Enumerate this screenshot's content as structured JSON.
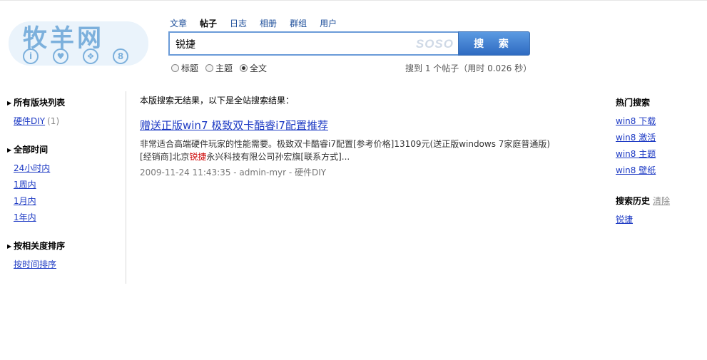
{
  "logo": {
    "brand": "牧羊网",
    "dots": [
      "i",
      "♥",
      "❖",
      "8"
    ]
  },
  "search": {
    "tabs": [
      "文章",
      "帖子",
      "日志",
      "相册",
      "群组",
      "用户"
    ],
    "active_tab": "帖子",
    "query": "锐捷",
    "engine_mark": "SOSO",
    "button_label": "搜 索",
    "scopes": [
      "标题",
      "主题",
      "全文"
    ],
    "selected_scope": "全文",
    "stats": "搜到 1 个帖子（用时 0.026 秒）"
  },
  "left": {
    "forums": {
      "heading": "所有版块列表",
      "items": [
        {
          "label": "硬件DIY",
          "count": "(1)"
        }
      ]
    },
    "time": {
      "heading": "全部时间",
      "items": [
        "24小时内",
        "1周内",
        "1月内",
        "1年内"
      ]
    },
    "sort": {
      "heading": "按相关度排序",
      "items": [
        "按时间排序"
      ]
    }
  },
  "main": {
    "notice": "本版搜索无结果，以下是全站搜索结果：",
    "results": [
      {
        "title": "赠送正版win7 极致双卡酷睿i7配置推荐",
        "snippet_before": "非常适合高端硬件玩家的性能需要。极致双卡酷睿i7配置[参考价格]13109元(送正版windows 7家庭普通版)[经销商]北京",
        "snippet_highlight": "锐捷",
        "snippet_after": "永兴科技有限公司孙宏旗[联系方式]...",
        "meta": "2009-11-24 11:43:35 - admin-myr - 硬件DIY"
      }
    ]
  },
  "right": {
    "hot": {
      "heading": "热门搜索",
      "items": [
        "win8 下载",
        "win8 激活",
        "win8 主题",
        "win8 壁纸"
      ]
    },
    "history": {
      "heading": "搜索历史",
      "clear_label": "清除",
      "items": [
        "锐捷"
      ]
    }
  }
}
